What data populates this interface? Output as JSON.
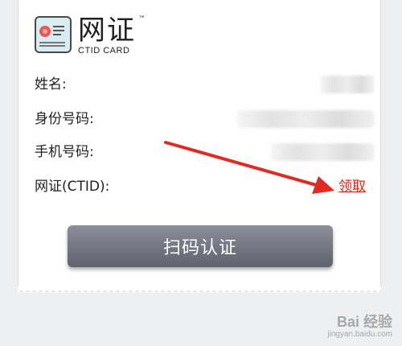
{
  "brand": {
    "name": "网证",
    "tm": "™",
    "subtitle": "CTID CARD"
  },
  "fields": [
    {
      "label": "姓名:"
    },
    {
      "label": "身份号码:"
    },
    {
      "label": "手机号码:"
    },
    {
      "label": "网证(CTID):"
    }
  ],
  "claim_link": "领取",
  "scan_button": "扫码认证",
  "watermark": {
    "main": "Bai 经验",
    "sub": "jingyan.baidu.com"
  },
  "colors": {
    "link": "#e0251a",
    "arrow": "#e02a22",
    "button_top": "#8c8f99",
    "button_bottom": "#5f626c"
  },
  "icons": {
    "logo": "id-card-icon",
    "annotation": "red-arrow-icon"
  }
}
